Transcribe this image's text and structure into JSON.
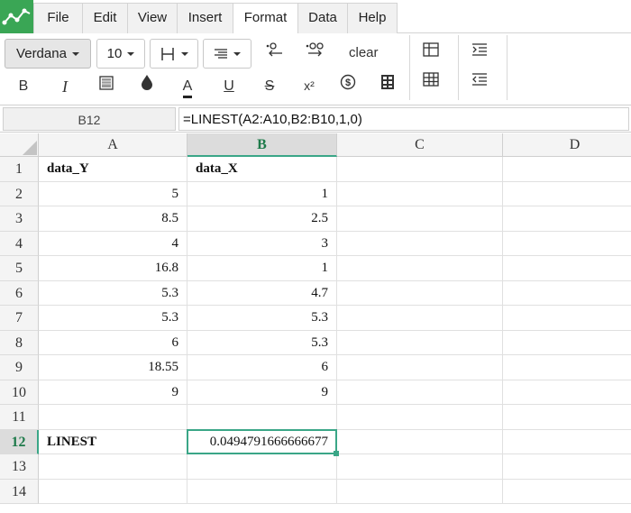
{
  "menu": {
    "items": [
      "File",
      "Edit",
      "View",
      "Insert",
      "Format",
      "Data",
      "Help"
    ],
    "active": "Format"
  },
  "toolbar": {
    "font_family": "Verdana",
    "font_size": "10",
    "clear_label": "clear",
    "icons_row1": [
      "borders-icon",
      "align-icon",
      "decrease-decimal-icon",
      "increase-decimal-icon"
    ],
    "icons_row2": [
      "bold-icon",
      "italic-icon",
      "background-icon",
      "fill-color-icon",
      "text-color-icon",
      "underline-icon",
      "strikethrough-icon",
      "superscript-icon",
      "currency-icon",
      "format-icon"
    ],
    "bold_glyph": "B",
    "italic_glyph": "I",
    "text_color_glyph": "A",
    "underline_glyph": "U",
    "strike_glyph": "S",
    "superscript_glyph": "x²",
    "currency_glyph": "$",
    "accent_color": "#3aa687"
  },
  "formula_bar": {
    "cell_ref": "B12",
    "formula": "=LINEST(A2:A10,B2:B10,1,0)"
  },
  "grid": {
    "columns": [
      "A",
      "B",
      "C",
      "D"
    ],
    "selected_column": "B",
    "rows": [
      "1",
      "2",
      "3",
      "4",
      "5",
      "6",
      "7",
      "8",
      "9",
      "10",
      "11",
      "12",
      "13",
      "14"
    ],
    "selected_row": "12",
    "cells": {
      "A1": "data_Y",
      "B1": "data_X",
      "A2": "5",
      "B2": "1",
      "A3": "8.5",
      "B3": "2.5",
      "A4": "4",
      "B4": "3",
      "A5": "16.8",
      "B5": "1",
      "A6": "5.3",
      "B6": "4.7",
      "A7": "5.3",
      "B7": "5.3",
      "A8": "6",
      "B8": "5.3",
      "A9": "18.55",
      "B9": "6",
      "A10": "9",
      "B10": "9",
      "A12": "LINEST",
      "B12": "0.0494791666666677"
    }
  }
}
